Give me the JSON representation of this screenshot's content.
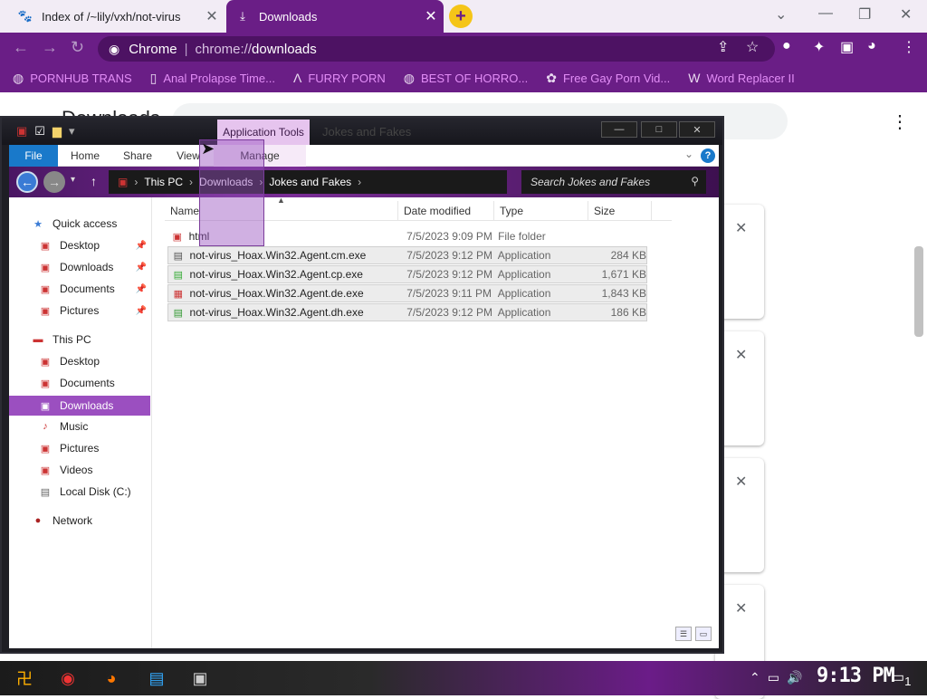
{
  "browser": {
    "tabs": [
      {
        "title": "Index of /~lily/vxh/not-virus",
        "icon": "page-favicon"
      },
      {
        "title": "Downloads",
        "icon": "download-icon"
      }
    ],
    "new_tab_symbol": "+",
    "omnibox": {
      "site_label": "Chrome",
      "url_prefix": "chrome://",
      "url_path": "downloads"
    },
    "bookmarks": [
      {
        "label": "PORNHUB TRANS",
        "icon": "globe-icon"
      },
      {
        "label": "Anal Prolapse Time...",
        "icon": "bookmark-icon"
      },
      {
        "label": "FURRY PORN",
        "icon": "lambda-icon"
      },
      {
        "label": "BEST OF HORRO...",
        "icon": "globe-icon"
      },
      {
        "label": "Free Gay Porn Vid...",
        "icon": "bookmark-icon"
      },
      {
        "label": "Word Replacer II",
        "icon": "extension-icon"
      }
    ],
    "downloads_page": {
      "title": "Downloads"
    }
  },
  "explorer": {
    "context_tab": "Application Tools",
    "window_title": "Jokes and Fakes",
    "ribbon_tabs": [
      "File",
      "Home",
      "Share",
      "View",
      "Manage"
    ],
    "path": [
      "This PC",
      "Downloads",
      "Jokes and Fakes"
    ],
    "search_placeholder": "Search Jokes and Fakes",
    "nav": {
      "quick_access": "Quick access",
      "quick_items": [
        "Desktop",
        "Downloads",
        "Documents",
        "Pictures"
      ],
      "this_pc": "This PC",
      "pc_items": [
        "Desktop",
        "Documents",
        "Downloads",
        "Music",
        "Pictures",
        "Videos",
        "Local Disk (C:)"
      ],
      "network": "Network"
    },
    "columns": {
      "name": "Name",
      "date": "Date modified",
      "type": "Type",
      "size": "Size"
    },
    "files": [
      {
        "name": "html",
        "date": "7/5/2023 9:09 PM",
        "type": "File folder",
        "size": ""
      },
      {
        "name": "not-virus_Hoax.Win32.Agent.cm.exe",
        "date": "7/5/2023 9:12 PM",
        "type": "Application",
        "size": "284 KB"
      },
      {
        "name": "not-virus_Hoax.Win32.Agent.cp.exe",
        "date": "7/5/2023 9:12 PM",
        "type": "Application",
        "size": "1,671 KB"
      },
      {
        "name": "not-virus_Hoax.Win32.Agent.de.exe",
        "date": "7/5/2023 9:11 PM",
        "type": "Application",
        "size": "1,843 KB"
      },
      {
        "name": "not-virus_Hoax.Win32.Agent.dh.exe",
        "date": "7/5/2023 9:12 PM",
        "type": "Application",
        "size": "186 KB"
      }
    ]
  },
  "taskbar": {
    "clock": "9:13 PM",
    "notification_count": "1"
  },
  "colors": {
    "accent": "#6a1e86",
    "selection": "#9b4fc0",
    "file_tab": "#1979ca"
  }
}
